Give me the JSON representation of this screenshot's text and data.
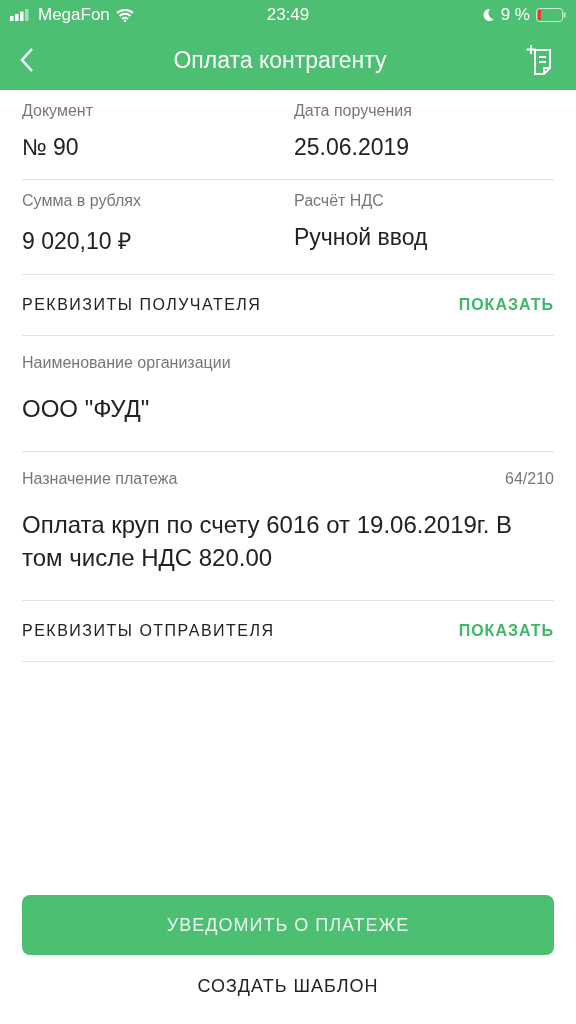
{
  "status_bar": {
    "carrier": "MegaFon",
    "time": "23:49",
    "battery": "9 %"
  },
  "nav": {
    "title": "Оплата контрагенту"
  },
  "fields": [
    {
      "label": "Документ",
      "value": "№ 90"
    },
    {
      "label": "Дата поручения",
      "value": "25.06.2019"
    },
    {
      "label": "Сумма в рублях",
      "value": "9 020,10 ₽"
    },
    {
      "label": "Расчёт НДС",
      "value": "Ручной ввод"
    }
  ],
  "recipient_section": {
    "title": "РЕКВИЗИТЫ ПОЛУЧАТЕЛЯ",
    "action": "ПОКАЗАТЬ"
  },
  "organization": {
    "label": "Наименование организации",
    "value": "ООО \"ФУД\""
  },
  "purpose": {
    "label": "Назначение платежа",
    "counter": "64/210",
    "value": "Оплата круп по счету 6016 от 19.06.2019г. В том числе НДС 820.00"
  },
  "sender_section": {
    "title": "РЕКВИЗИТЫ ОТПРАВИТЕЛЯ",
    "action": "ПОКАЗАТЬ"
  },
  "buttons": {
    "primary": "УВЕДОМИТЬ О ПЛАТЕЖЕ",
    "secondary": "СОЗДАТЬ ШАБЛОН"
  }
}
